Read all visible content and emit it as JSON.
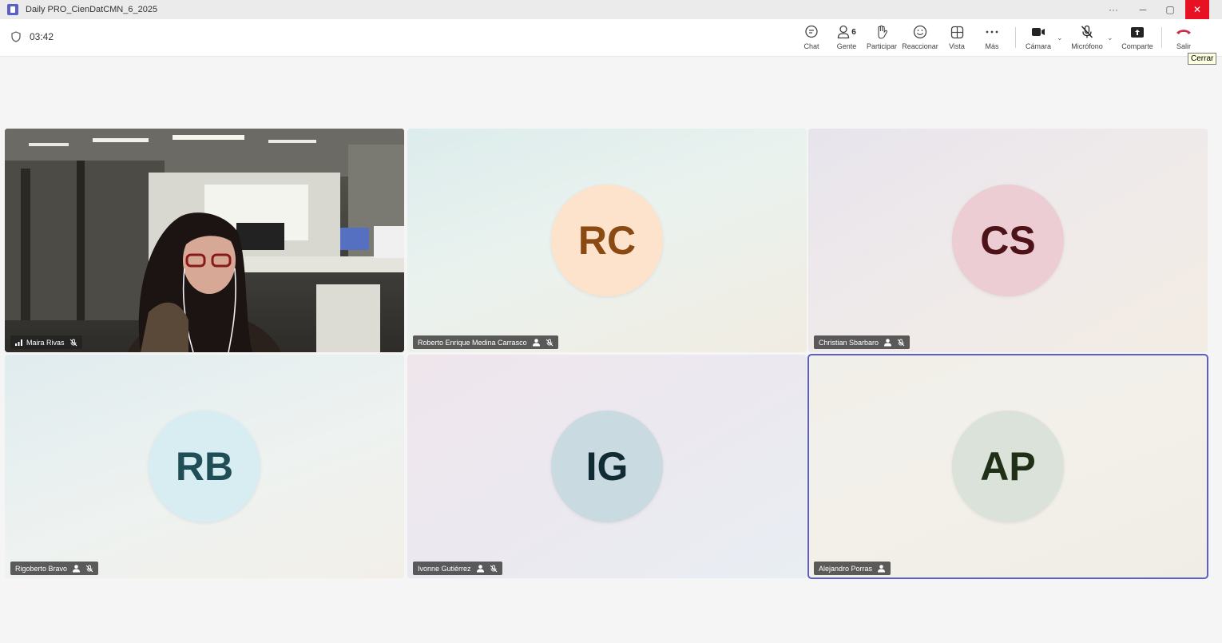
{
  "window": {
    "title": "Daily PRO_CienDatCMN_6_2025",
    "controls": {
      "more": "···",
      "minimize": "─",
      "restore": "▢",
      "close": "✕"
    }
  },
  "toolbar": {
    "timer": "03:42",
    "people_count": "6",
    "buttons": {
      "chat": "Chat",
      "people": "Gente",
      "raise": "Participar",
      "react": "Reaccionar",
      "view": "Vista",
      "more": "Más",
      "camera": "Cámara",
      "mic": "Micrófono",
      "share": "Comparte",
      "leave": "Salir"
    },
    "tooltip": "Cerrar"
  },
  "participants": [
    {
      "name": "Maira Rivas",
      "initials": "",
      "video": true,
      "bg": "#4a4a44"
    },
    {
      "name": "Roberto Enrique Medina Carrasco",
      "initials": "RC",
      "avatar_bg": "#fde3cc",
      "avatar_fg": "#8a4a12"
    },
    {
      "name": "Christian Sbarbaro",
      "initials": "CS",
      "avatar_bg": "#ebcdd3",
      "avatar_fg": "#4e1219"
    },
    {
      "name": "Rigoberto Bravo",
      "initials": "RB",
      "avatar_bg": "#d7edf2",
      "avatar_fg": "#1f4e57"
    },
    {
      "name": "Ivonne Gutiérrez",
      "initials": "IG",
      "avatar_bg": "#c9dae1",
      "avatar_fg": "#102b33"
    },
    {
      "name": "Alejandro Porras",
      "initials": "AP",
      "avatar_bg": "#dbe2d9",
      "avatar_fg": "#1f3016"
    }
  ],
  "colors": {
    "accent": "#5b5fc7",
    "leave": "#c4314b"
  }
}
